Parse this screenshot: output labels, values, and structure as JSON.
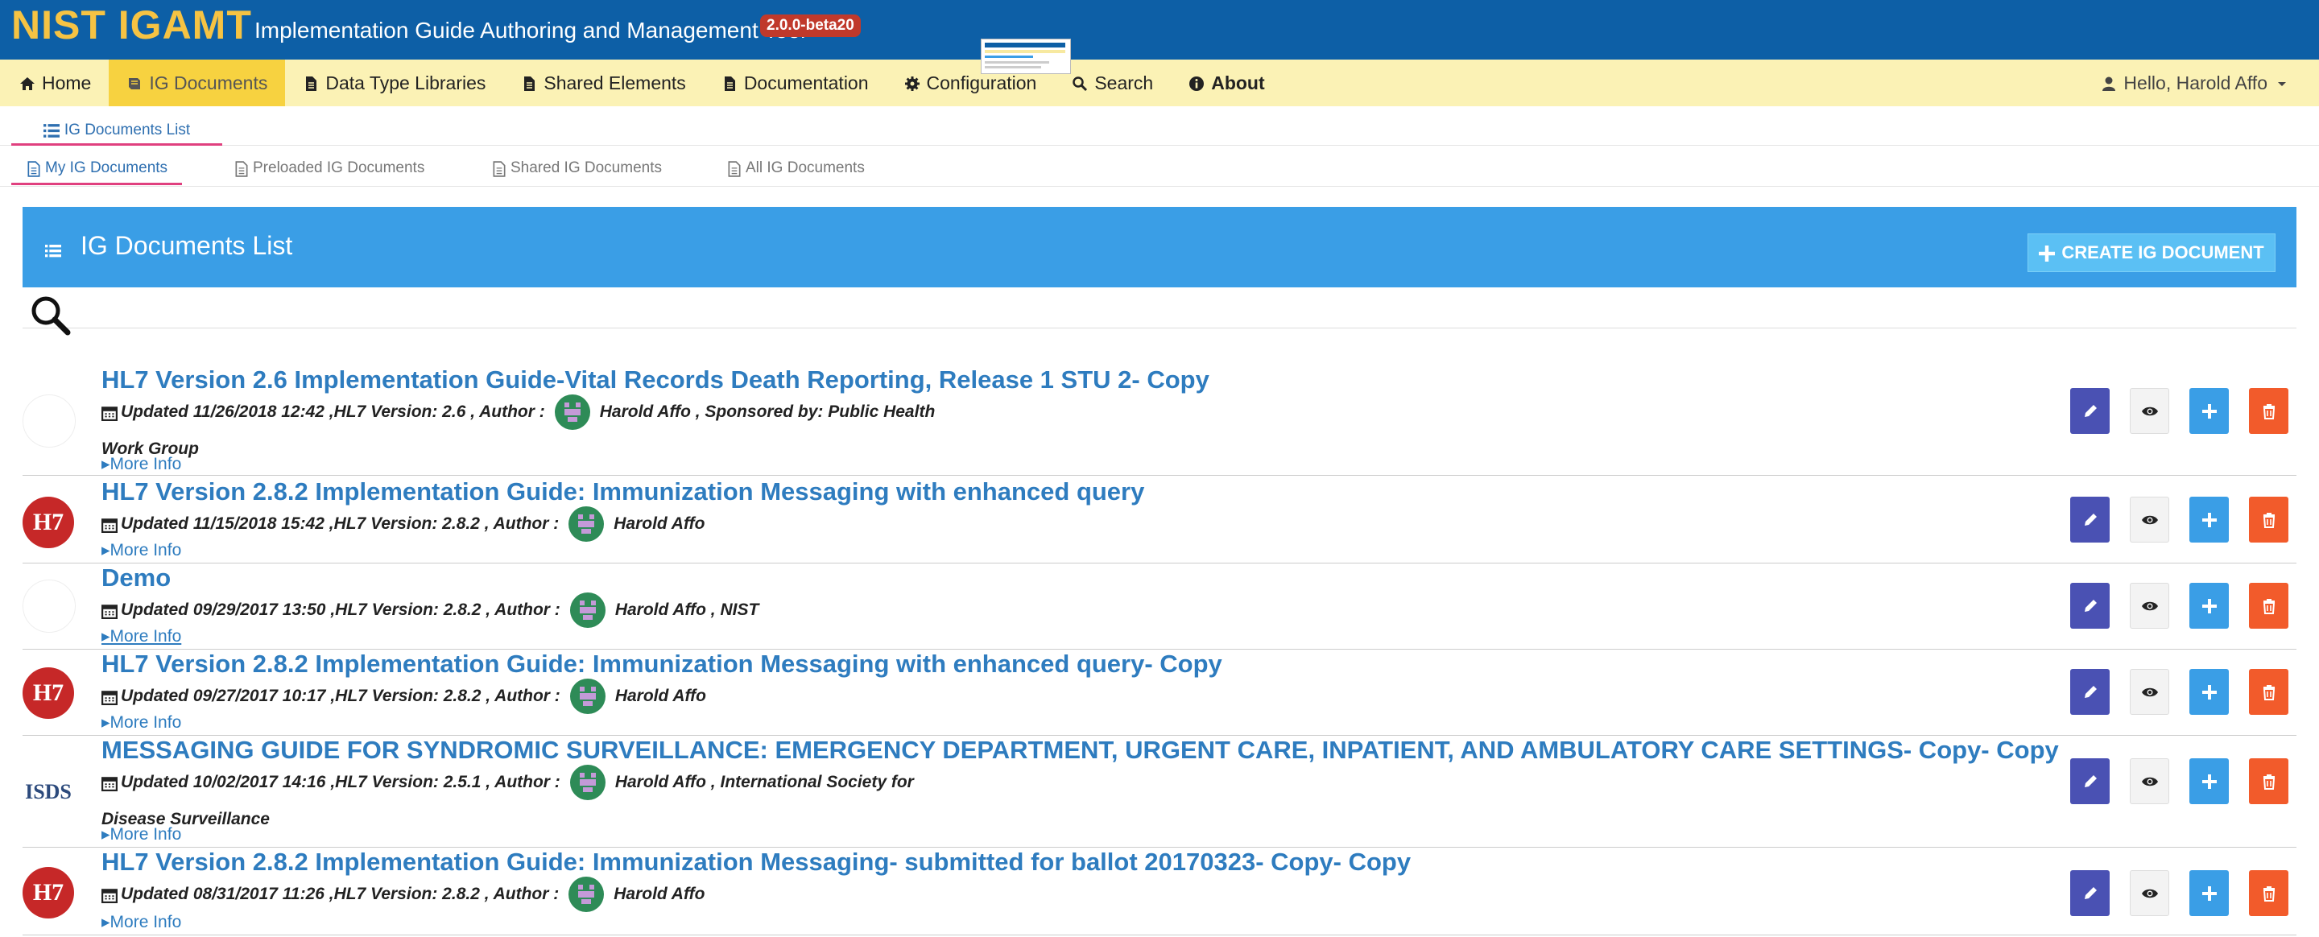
{
  "header": {
    "brand": "NIST IGAMT",
    "subtitle": "Implementation Guide Authoring and Management Tool",
    "version": "2.0.0-beta20"
  },
  "nav": {
    "items": [
      {
        "label": "Home",
        "icon": "home-icon"
      },
      {
        "label": "IG Documents",
        "icon": "book-icon"
      },
      {
        "label": "Data Type Libraries",
        "icon": "file-icon"
      },
      {
        "label": "Shared Elements",
        "icon": "file-icon"
      },
      {
        "label": "Documentation",
        "icon": "file-icon"
      },
      {
        "label": "Configuration",
        "icon": "gear-icon"
      },
      {
        "label": "Search",
        "icon": "search-icon"
      },
      {
        "label": "About",
        "icon": "info-icon"
      }
    ],
    "user": "Hello, Harold Affo"
  },
  "tabs": {
    "top": "IG Documents List",
    "sub": [
      "My IG Documents",
      "Preloaded IG Documents",
      "Shared IG Documents",
      "All IG Documents"
    ]
  },
  "panel": {
    "title": "IG Documents List",
    "create": "CREATE IG DOCUMENT"
  },
  "more_info": "More Info",
  "documents": [
    {
      "title": "HL7 Version 2.6 Implementation Guide-Vital Records Death Reporting, Release 1 STU 2- Copy",
      "meta": "Updated 11/26/2018 12:42 ,HL7 Version: 2.6 , Author :",
      "author": "Harold Affo , Sponsored by: Public Health",
      "meta2": "Work Group",
      "logo": "blank"
    },
    {
      "title": "HL7 Version 2.8.2 Implementation Guide: Immunization Messaging with enhanced query",
      "meta": "Updated 11/15/2018 15:42 ,HL7 Version: 2.8.2 , Author :",
      "author": "Harold Affo",
      "logo": "hl7"
    },
    {
      "title": "Demo",
      "meta": "Updated 09/29/2017 13:50 ,HL7 Version: 2.8.2 , Author :",
      "author": "Harold Affo , NIST",
      "logo": "blank"
    },
    {
      "title": "HL7 Version 2.8.2 Implementation Guide: Immunization Messaging with enhanced query- Copy",
      "meta": "Updated 09/27/2017 10:17 ,HL7 Version: 2.8.2 , Author :",
      "author": "Harold Affo",
      "logo": "hl7"
    },
    {
      "title": "MESSAGING GUIDE FOR SYNDROMIC SURVEILLANCE: EMERGENCY DEPARTMENT, URGENT CARE, INPATIENT, AND AMBULATORY CARE SETTINGS- Copy- Copy",
      "meta": "Updated 10/02/2017 14:16 ,HL7 Version: 2.5.1 , Author :",
      "author": "Harold Affo , International Society for",
      "meta2": "Disease Surveillance",
      "logo": "isds"
    },
    {
      "title": "HL7 Version 2.8.2 Implementation Guide: Immunization Messaging- submitted for ballot 20170323- Copy- Copy",
      "meta": "Updated 08/31/2017 11:26 ,HL7 Version: 2.8.2 , Author :",
      "author": "Harold Affo",
      "logo": "hl7"
    }
  ],
  "logo_text": {
    "hl7": "H7",
    "isds": "ISDS"
  },
  "colors": {
    "header": "#0d5fa6",
    "brand": "#f6c343",
    "navbar": "#fbf2b5",
    "nav_active": "#f7d240",
    "panel": "#3a9ee6",
    "edit": "#4a51b3",
    "add": "#3a9ee6",
    "delete": "#f25b2b",
    "link": "#2e7cbf"
  }
}
